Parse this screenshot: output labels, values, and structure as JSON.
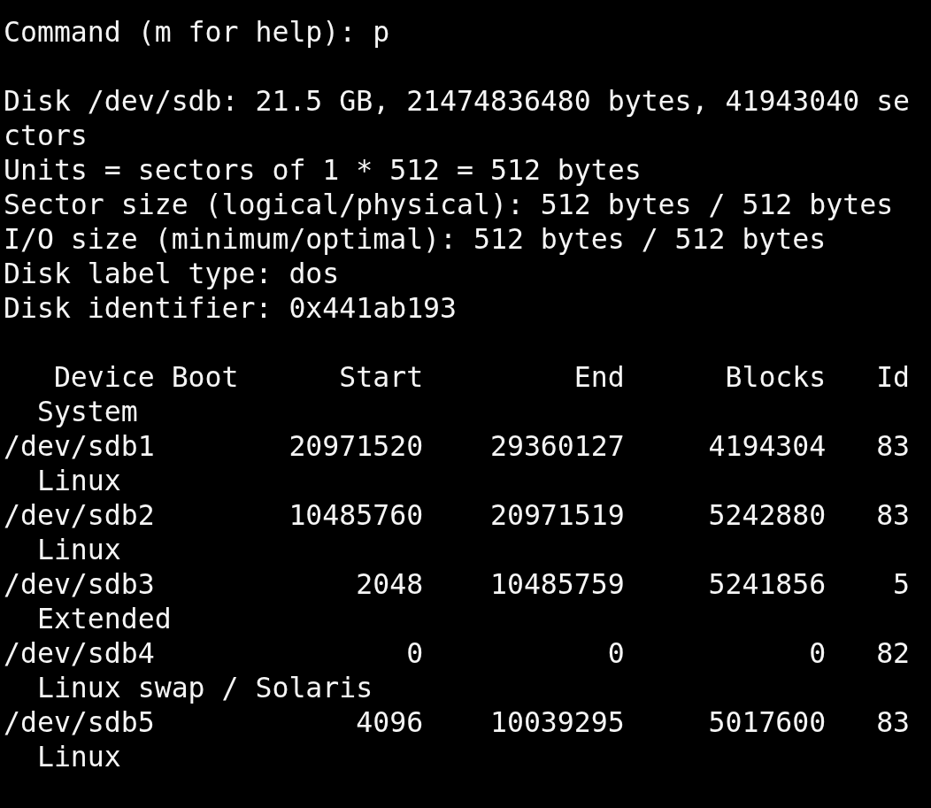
{
  "terminal": {
    "sections": [
      {
        "lines": [
          "Command (m for help): p"
        ]
      },
      {
        "lines": [
          "Disk /dev/sdb: 21.5 GB, 21474836480 bytes, 41943040 se",
          "ctors",
          "Units = sectors of 1 * 512 = 512 bytes",
          "Sector size (logical/physical): 512 bytes / 512 bytes",
          "I/O size (minimum/optimal): 512 bytes / 512 bytes",
          "Disk label type: dos",
          "Disk identifier: 0x441ab193"
        ]
      },
      {
        "lines": [
          "   Device Boot      Start         End      Blocks   Id",
          "  System",
          "/dev/sdb1        20971520    29360127     4194304   83",
          "  Linux",
          "/dev/sdb2        10485760    20971519     5242880   83",
          "  Linux",
          "/dev/sdb3            2048    10485759     5241856    5",
          "  Extended",
          "/dev/sdb4               0           0           0   82",
          "  Linux swap / Solaris",
          "/dev/sdb5            4096    10039295     5017600   83",
          "  Linux"
        ]
      }
    ]
  }
}
